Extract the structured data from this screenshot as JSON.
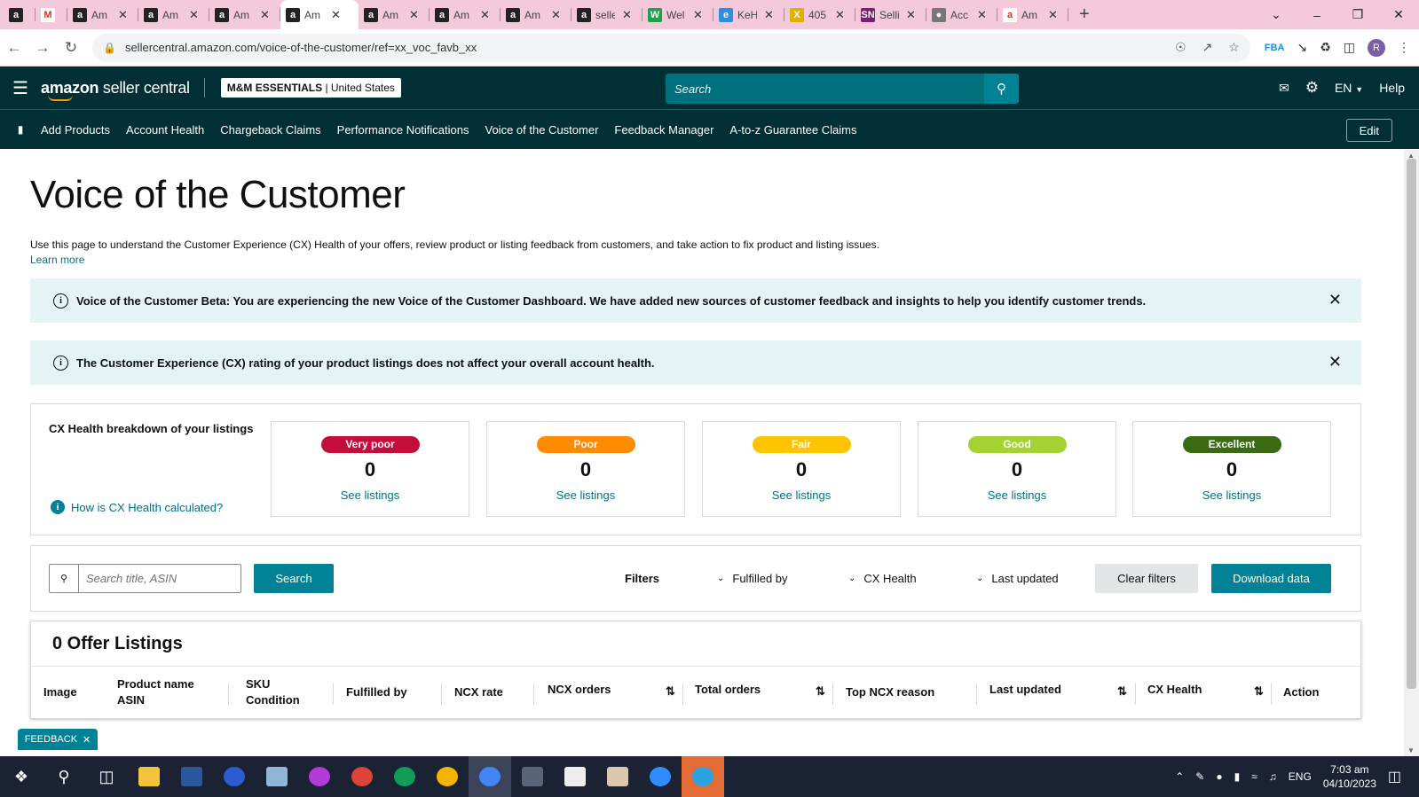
{
  "browser": {
    "tabs": [
      {
        "icon_text": "a",
        "icon_color": "#222222",
        "title": "",
        "closable": false
      },
      {
        "icon_text": "M",
        "icon_color": "#ffffff",
        "title": "",
        "closable": false
      },
      {
        "icon_text": "a",
        "icon_color": "#222222",
        "title": "Am",
        "closable": true
      },
      {
        "icon_text": "a",
        "icon_color": "#222222",
        "title": "Am",
        "closable": true
      },
      {
        "icon_text": "a",
        "icon_color": "#222222",
        "title": "Am",
        "closable": true
      },
      {
        "icon_text": "a",
        "icon_color": "#222222",
        "title": "Am",
        "closable": true,
        "active": true
      },
      {
        "icon_text": "a",
        "icon_color": "#222222",
        "title": "Am",
        "closable": true
      },
      {
        "icon_text": "a",
        "icon_color": "#222222",
        "title": "Am",
        "closable": true
      },
      {
        "icon_text": "a",
        "icon_color": "#222222",
        "title": "Am",
        "closable": true
      },
      {
        "icon_text": "a",
        "icon_color": "#222222",
        "title": "selle",
        "closable": true
      },
      {
        "icon_text": "W",
        "icon_color": "#21a04a",
        "title": "Wel",
        "closable": true
      },
      {
        "icon_text": "e",
        "icon_color": "#2e8ee0",
        "title": "KeH",
        "closable": true
      },
      {
        "icon_text": "X",
        "icon_color": "#e0b000",
        "title": "405",
        "closable": true
      },
      {
        "icon_text": "SN",
        "icon_color": "#7a1f6e",
        "title": "Selli",
        "closable": true
      },
      {
        "icon_text": "●",
        "icon_color": "#777777",
        "title": "Acc",
        "closable": true
      },
      {
        "icon_text": "a",
        "icon_color": "#ffffff",
        "title": "Am",
        "closable": true
      }
    ],
    "new_tab": "+",
    "url": "sellercentral.amazon.com/voice-of-the-customer/ref=xx_voc_favb_xx",
    "avatar_letter": "R"
  },
  "header": {
    "brand_main": "amazon",
    "brand_sub": " seller central",
    "store_name": "M&M ESSENTIALS",
    "store_region": " | United States",
    "search_placeholder": "Search",
    "language": "EN",
    "help": "Help"
  },
  "nav": {
    "items": [
      "Add Products",
      "Account Health",
      "Chargeback Claims",
      "Performance Notifications",
      "Voice of the Customer",
      "Feedback Manager",
      "A-to-z Guarantee Claims"
    ],
    "edit": "Edit"
  },
  "page": {
    "title": "Voice of the Customer",
    "intro": "Use this page to understand the Customer Experience (CX) Health of your offers, review product or listing feedback from customers, and take action to fix product and listing issues.",
    "learn_more": "Learn more"
  },
  "alerts": [
    "Voice of the Customer Beta: You are experiencing the new Voice of the Customer Dashboard. We have added new sources of customer feedback and insights to help you identify customer trends.",
    "The Customer Experience (CX) rating of your product listings does not affect your overall account health."
  ],
  "breakdown": {
    "title": "CX Health breakdown of your listings",
    "how_link": "How is CX Health calculated?",
    "cards": [
      {
        "label": "Very poor",
        "count": "0",
        "link": "See listings",
        "color": "#c40e3a"
      },
      {
        "label": "Poor",
        "count": "0",
        "link": "See listings",
        "color": "#ff8c00"
      },
      {
        "label": "Fair",
        "count": "0",
        "link": "See listings",
        "color": "#ffc400"
      },
      {
        "label": "Good",
        "count": "0",
        "link": "See listings",
        "color": "#a4d233"
      },
      {
        "label": "Excellent",
        "count": "0",
        "link": "See listings",
        "color": "#3a6b12"
      }
    ]
  },
  "filters": {
    "search_placeholder": "Search title, ASIN",
    "search_button": "Search",
    "label": "Filters",
    "dropdowns": [
      "Fulfilled by",
      "CX Health",
      "Last updated"
    ],
    "clear": "Clear filters",
    "download": "Download data"
  },
  "listings": {
    "title": "0 Offer Listings",
    "columns": [
      {
        "l1": "Image",
        "l2": ""
      },
      {
        "l1": "Product name",
        "l2": "ASIN"
      },
      {
        "l1": "SKU",
        "l2": "Condition"
      },
      {
        "l1": "Fulfilled by",
        "l2": ""
      },
      {
        "l1": "NCX rate",
        "l2": ""
      },
      {
        "l1": "NCX orders",
        "l2": ""
      },
      {
        "l1": "Total orders",
        "l2": ""
      },
      {
        "l1": "Top NCX reason",
        "l2": ""
      },
      {
        "l1": "Last updated",
        "l2": ""
      },
      {
        "l1": "CX Health",
        "l2": ""
      },
      {
        "l1": "Action",
        "l2": ""
      }
    ]
  },
  "feedback_tab": "FEEDBACK",
  "taskbar": {
    "language": "ENG",
    "time": "7:03 am",
    "date": "04/10/2023"
  }
}
